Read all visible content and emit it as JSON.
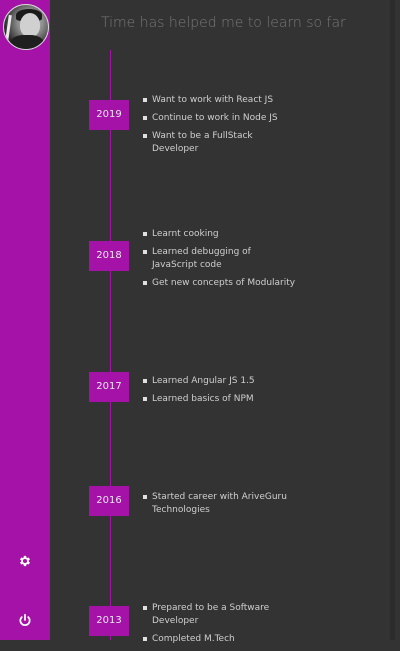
{
  "heading": "Time has helped me to learn so far",
  "sidebar": {
    "settings_icon": "gear-icon",
    "logout_icon": "power-icon",
    "accent_color": "#a412a8"
  },
  "timeline": [
    {
      "year": "2019",
      "items": [
        "Want to work with React JS",
        "Continue to work in Node JS",
        "Want to be a FullStack Developer"
      ]
    },
    {
      "year": "2018",
      "items": [
        "Learnt cooking",
        "Learned debugging of JavaScript code",
        "Get new concepts of Modularity"
      ]
    },
    {
      "year": "2017",
      "items": [
        "Learned Angular JS 1.5",
        "Learned basics of NPM"
      ]
    },
    {
      "year": "2016",
      "items": [
        "Started career with AriveGuru Technologies"
      ]
    },
    {
      "year": "2013",
      "items": [
        "Prepared to be a Software Developer",
        "Completed M.Tech"
      ]
    }
  ]
}
